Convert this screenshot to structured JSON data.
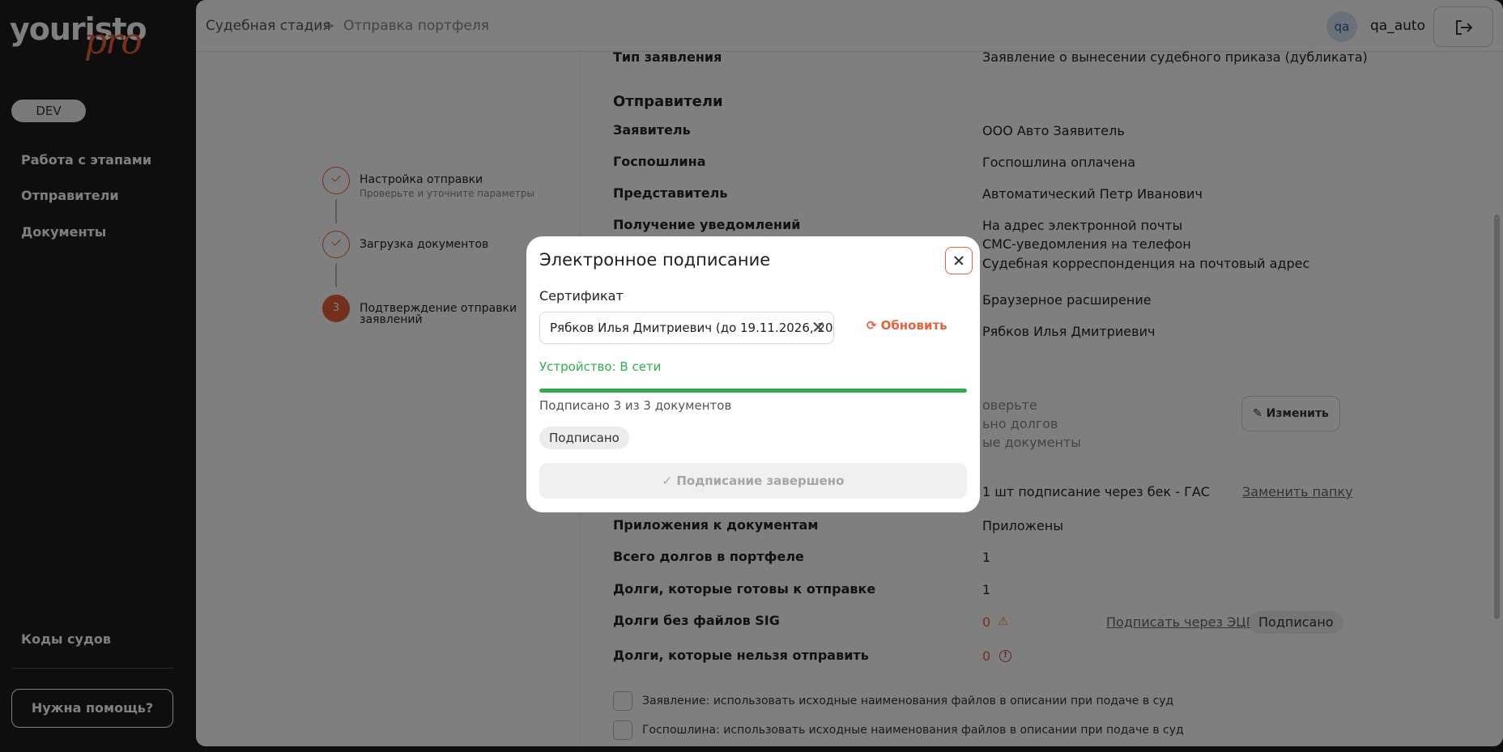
{
  "sidebar": {
    "logo_text": "youristo",
    "logo_pro": "pro",
    "env_badge": "DEV",
    "nav": [
      "Работа с этапами",
      "Отправители",
      "Документы"
    ],
    "courts_codes": "Коды судов",
    "help_button": "Нужна помощь?"
  },
  "header": {
    "breadcrumb": [
      "Судебная стадия",
      "Отправка портфеля"
    ],
    "breadcrumb_separator": ">",
    "avatar_initials": "qa",
    "username": "qa_auto"
  },
  "stepper": {
    "steps": [
      {
        "title": "Настройка отправки",
        "subtitle": "Проверьте и уточните параметры",
        "status": "done"
      },
      {
        "title": "Загрузка документов",
        "subtitle": "",
        "status": "done"
      },
      {
        "title_line1": "Подтверждение отправки",
        "title_line2": "заявлений",
        "number": "3",
        "status": "active"
      }
    ]
  },
  "details": {
    "app_type_label": "Тип заявления",
    "app_type_value": "Заявление о вынесении судебного приказа (дубликата)",
    "senders_title": "Отправители",
    "applicant_label": "Заявитель",
    "applicant_value": "ООО Авто Заявитель",
    "fee_label": "Госпошлина",
    "fee_value": "Госпошлина оплачена",
    "rep_label": "Представитель",
    "rep_value": "Автоматический Петр Иванович",
    "notify_label": "Получение уведомлений",
    "notify_values": [
      "На адрес электронной почты",
      "СМС-уведомления на телефон",
      "Судебная корреспонденция на почтовый адрес"
    ],
    "sign_method_value": "Браузерное расширение",
    "signer_value": "Рябков Илья Дмитриевич",
    "partial_1": "оверьте",
    "partial_2": "ьно долгов",
    "partial_3": "ые документы",
    "edit_button": "Изменить",
    "folder_value": "1 шт подписание через бек - ГАС",
    "replace_folder_link": "Заменить папку",
    "attachments_label": "Приложения к документам",
    "attachments_value": "Приложены",
    "total_debts_label": "Всего долгов в портфеле",
    "total_debts_value": "1",
    "ready_debts_label": "Долги, которые готовы к отправке",
    "ready_debts_value": "1",
    "no_sig_label": "Долги без файлов SIG",
    "no_sig_value": "0",
    "sign_ecp_link": "Подписать через ЭЦП",
    "signed_pill": "Подписано",
    "cannot_send_label": "Долги, которые нельзя отправить",
    "cannot_send_value": "0",
    "checkbox_1": "Заявление: использовать исходные наименования файлов в описании при подаче в суд",
    "checkbox_2": "Госпошлина: использовать исходные наименования файлов в описании при подаче в суд"
  },
  "modal": {
    "title": "Электронное подписание",
    "cert_label": "Сертификат",
    "cert_value": "Рябков Илья Дмитриевич (до 19.11.2026, 20",
    "refresh_button": "Обновить",
    "device_status": "Устройство: В сети",
    "progress": 1.0,
    "progress_text": "Подписано 3 из 3 документов",
    "status_pill": "Подписано",
    "done_button": "Подписание завершено"
  },
  "colors": {
    "accent": "#e8613a",
    "success": "#2db04b",
    "sidebar_bg": "#1c1c1c"
  }
}
